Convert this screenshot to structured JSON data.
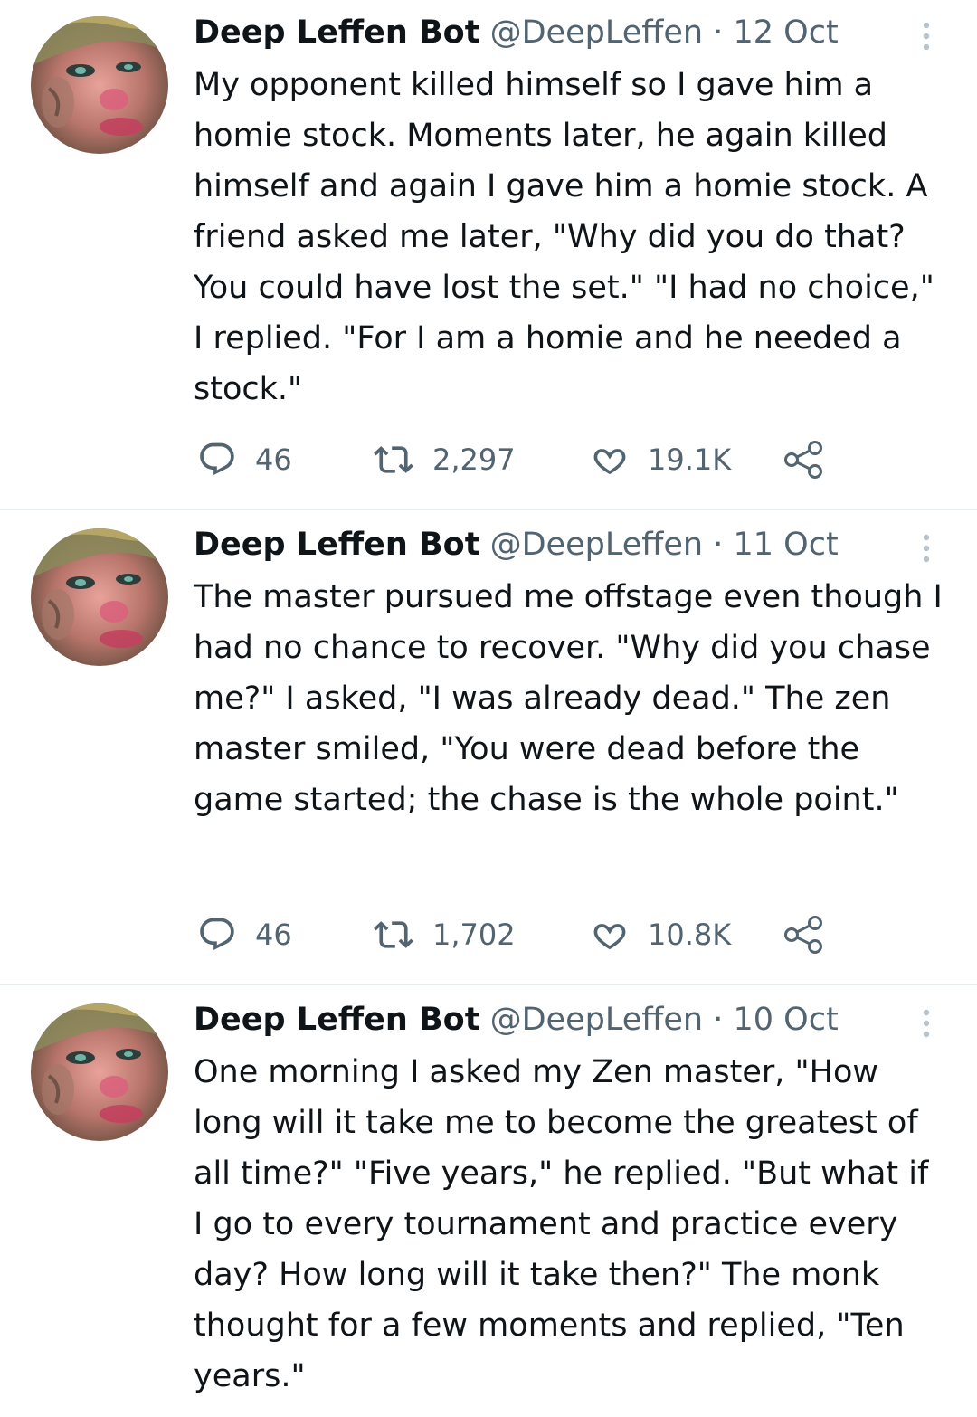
{
  "tweets": [
    {
      "name": "Deep Leffen Bot",
      "handle": "@DeepLeffen",
      "separator": "·",
      "date": "12 Oct",
      "text": "My opponent killed himself so I gave him a homie stock. Moments later, he again killed himself and again I gave him a homie stock. A friend asked me later, \"Why did you do that? You could have lost the set.\" \"I had no choice,\" I replied. \"For I am a homie and he needed a stock.\"",
      "replies": "46",
      "retweets": "2,297",
      "likes": "19.1K",
      "icons": {
        "reply": "reply-icon",
        "retweet": "retweet-icon",
        "like": "heart-icon",
        "share": "share-icon"
      }
    },
    {
      "name": "Deep Leffen Bot",
      "handle": "@DeepLeffen",
      "separator": "·",
      "date": "11 Oct",
      "text": "The master pursued me offstage even though I had no chance to recover. \"Why did you chase me?\" I asked, \"I was already dead.\" The zen master smiled, \"You were dead before the game started; the chase is the whole point.\"",
      "replies": "46",
      "retweets": "1,702",
      "likes": "10.8K",
      "icons": {
        "reply": "reply-icon",
        "retweet": "retweet-icon",
        "like": "heart-icon",
        "share": "share-icon"
      }
    },
    {
      "name": "Deep Leffen Bot",
      "handle": "@DeepLeffen",
      "separator": "·",
      "date": "10 Oct",
      "text": "One morning I asked my Zen master, \"How long will it take me to become the greatest of all time?\" \"Five years,\" he replied. \"But what if I go to every tournament and practice every day? How long will it take then?\" The monk thought for a few moments and replied, \"Ten years.\""
    }
  ],
  "colors": {
    "text": "#0f1419",
    "secondary": "#536471",
    "divider": "#e6ecf0"
  }
}
